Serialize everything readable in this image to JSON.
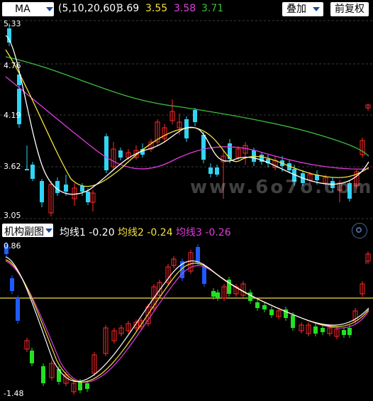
{
  "toolbar": {
    "ma_select_label": "MA",
    "ma_params": "(5,10,20,60)",
    "ma_values": [
      "3.69",
      "3.55",
      "3.58",
      "3.71"
    ],
    "overlay_label": "叠加",
    "adjust_label": "前复权"
  },
  "main_chart": {
    "price_axis": [
      "5.33",
      "4.76",
      "4.19",
      "3.62",
      "3.05"
    ],
    "watermark": "www.6o7o.com",
    "colors": {
      "up": "#ff2a2a",
      "down": "#31d4f5",
      "ma5": "#ffffff",
      "ma10": "#f5e03c",
      "ma20": "#e03ce0",
      "ma60": "#3cbe3c"
    }
  },
  "sub_chart": {
    "select_label": "机构副图",
    "indicators": [
      {
        "label": "均线1",
        "value": "-0.20",
        "color": "#ffffff"
      },
      {
        "label": "均线2",
        "value": "-0.24",
        "color": "#f5e03c"
      },
      {
        "label": "均线3",
        "value": "-0.26",
        "color": "#e03ce0"
      }
    ],
    "axis": [
      "0.86",
      "-1.48"
    ],
    "colors": {
      "zero_line": "#f5e03c",
      "red": "#ff2a2a",
      "green": "#22e022",
      "blue": "#1e5bff"
    }
  }
}
